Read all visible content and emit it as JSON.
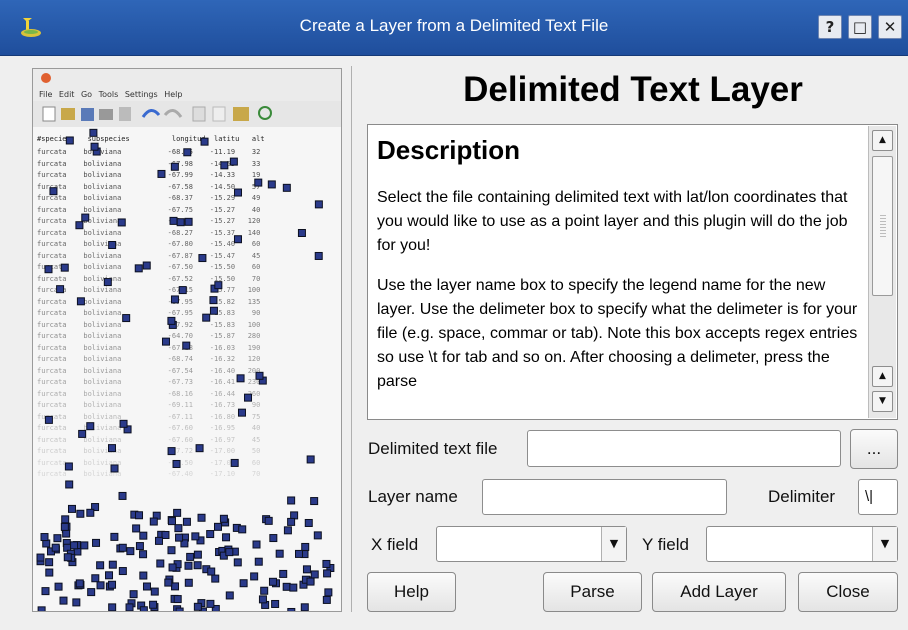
{
  "window": {
    "title": "Create a Layer from a Delimited Text File",
    "controls": [
      "?",
      "□",
      "✕"
    ]
  },
  "preview": {
    "menu": "File Edit Go Tools Settings Help",
    "header": "#species    subspecies          longitud  latitu   alt",
    "rows": [
      "furcata    boliviana           -68.85    -11.19    32",
      "furcata    boliviana           -67.98    -14.53    33",
      "furcata    boliviana           -67.99    -14.33    19",
      "furcata    boliviana           -67.58    -14.50    57",
      "furcata    boliviana           -68.37    -15.29    49",
      "furcata    boliviana           -67.75    -15.27    40",
      "furcata    boliviana           -68.48    -15.27   120",
      "furcata    boliviana           -68.27    -15.37   140",
      "furcata    boliviana           -67.80    -15.40    60",
      "furcata    boliviana           -67.87    -15.47    45",
      "furcata    boliviana           -67.50    -15.50    60",
      "furcata    boliviana           -67.52    -15.50    70",
      "furcata    boliviana           -67.15    -15.77   100",
      "furcata    boliviana           -67.95    -15.82   135",
      "furcata    boliviana           -67.95    -15.83    90",
      "furcata    boliviana           -67.92    -15.83   100",
      "furcata    boliviana           -64.70    -15.87   280",
      "furcata    boliviana           -67.18    -16.03   190",
      "furcata    boliviana           -68.74    -16.32   120",
      "furcata    boliviana           -67.54    -16.40   200",
      "furcata    boliviana           -67.73    -16.41   230",
      "furcata    boliviana           -68.16    -16.44   260",
      "furcata    boliviana           -69.11    -16.73    90",
      "furcata    boliviana           -67.11    -16.80    75",
      "furcata    boliviana           -67.60    -16.95    40",
      "furcata    boliviana           -67.60    -16.97    45",
      "furcata    boliviana           -67.72    -17.00    50",
      "furcata    boliviana           -67.50    -17.05    60",
      "furcata    boliviana           -67.40    -17.10    70"
    ]
  },
  "heading": "Delimited Text Layer",
  "description": {
    "title": "Description",
    "p1": "Select the file containing delimited text with lat/lon coordinates that you would like to use as a point layer and this plugin will do the job for you!",
    "p2": "Use the layer name box to specify the legend name for the new layer. Use the delimeter box to specify what the delimeter is for your file (e.g. space, commar or tab). Note this box accepts regex entries so use \\t for tab and so on. After choosing a delimeter, press the parse"
  },
  "form": {
    "delimited_file_label": "Delimited text file",
    "delimited_file_value": "",
    "browse_label": "...",
    "layer_name_label": "Layer name",
    "layer_name_value": "",
    "delimiter_label": "Delimiter",
    "delimiter_value": "\\|",
    "x_field_label": "X field",
    "x_field_value": "",
    "y_field_label": "Y field",
    "y_field_value": ""
  },
  "buttons": {
    "help": "Help",
    "parse": "Parse",
    "add_layer": "Add Layer",
    "close": "Close"
  },
  "colors": {
    "titlebar": "#2a5db0",
    "point_fill": "#2a3a8a"
  }
}
